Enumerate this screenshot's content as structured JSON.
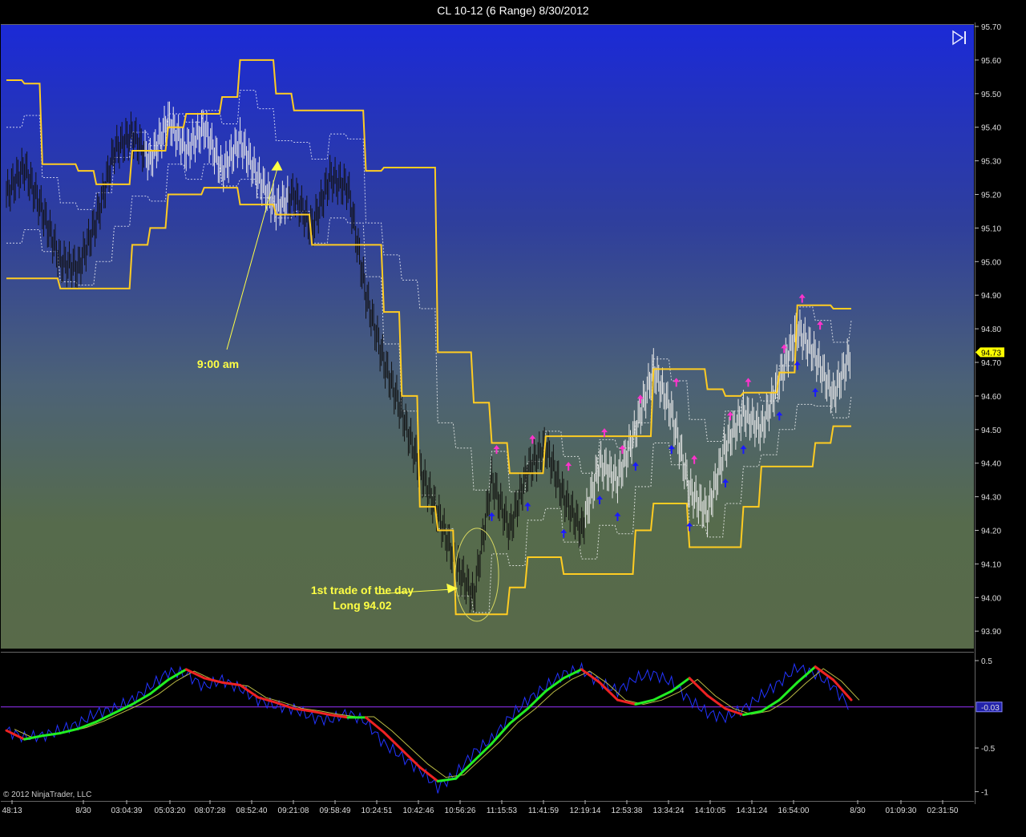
{
  "window": {
    "title": "CL 10-12 (6 Range)  8/30/2012"
  },
  "footer": {
    "copyright": "© 2012 NinjaTrader, LLC"
  },
  "icons": {
    "skip_end": "skip-to-end-icon"
  },
  "colors": {
    "band": "#ffcc22",
    "price_bar": "#111111",
    "bull_arrow": "#1a1aff",
    "bear_arrow": "#ff33cc",
    "osc_blue": "#2233ff",
    "osc_up": "#22ee22",
    "osc_down": "#ee2222",
    "osc_zero_line": "#9933ff"
  },
  "annotations": {
    "first_trade_line1": "1st trade of the day",
    "first_trade_line2": "Long 94.02",
    "nine_am": "9:00 am"
  },
  "chart_data": [
    {
      "type": "line",
      "panel": "price",
      "title": "CL 10-12 (6 Range)  8/30/2012",
      "yaxis_ticks": [
        "95.70",
        "95.60",
        "95.50",
        "95.40",
        "95.30",
        "95.20",
        "95.10",
        "95.00",
        "94.90",
        "94.80",
        "94.70",
        "94.60",
        "94.50",
        "94.40",
        "94.30",
        "94.20",
        "94.10",
        "94.00",
        "93.90"
      ],
      "ylim": [
        93.87,
        95.72
      ],
      "current_price_label": "94.73",
      "current_price": 94.73,
      "x_ticks": [
        "48:13",
        "8/30",
        "03:04:39",
        "05:03:20",
        "08:07:28",
        "08:52:40",
        "09:21:08",
        "09:58:49",
        "10:24:51",
        "10:42:46",
        "10:56:26",
        "11:15:53",
        "11:41:59",
        "12:19:14",
        "12:53:38",
        "13:34:24",
        "14:10:05",
        "14:31:24",
        "16:54:00",
        "8/30",
        "01:09:30",
        "02:31:50"
      ],
      "series": [
        {
          "name": "",
          "role": "upper-band",
          "values": [
            95.54,
            95.53,
            95.29,
            95.29,
            95.27,
            95.23,
            95.23,
            95.33,
            95.33,
            95.4,
            95.44,
            95.44,
            95.49,
            95.6,
            95.6,
            95.5,
            95.45,
            95.45,
            95.45,
            95.45,
            95.27,
            95.28,
            95.28,
            95.28,
            94.73,
            94.73,
            94.58,
            94.46,
            94.37,
            94.37,
            94.48,
            94.48,
            94.48,
            94.48,
            94.48,
            94.48,
            94.68,
            94.68,
            94.68,
            94.62,
            94.6,
            94.61,
            94.61,
            94.67,
            94.87,
            94.87,
            94.86,
            94.86
          ]
        },
        {
          "name": "",
          "role": "lower-band",
          "values": [
            94.95,
            94.95,
            94.95,
            94.92,
            94.92,
            94.92,
            94.92,
            95.05,
            95.1,
            95.2,
            95.2,
            95.22,
            95.22,
            95.17,
            95.17,
            95.14,
            95.14,
            95.05,
            95.05,
            95.05,
            95.05,
            94.85,
            94.6,
            94.27,
            94.2,
            93.95,
            93.95,
            93.95,
            94.03,
            94.12,
            94.12,
            94.07,
            94.07,
            94.07,
            94.07,
            94.2,
            94.28,
            94.28,
            94.15,
            94.15,
            94.15,
            94.27,
            94.39,
            94.39,
            94.39,
            94.46,
            94.51,
            94.51
          ]
        },
        {
          "name": "",
          "role": "price-close",
          "values": [
            95.2,
            95.28,
            95.15,
            95.0,
            94.98,
            95.12,
            95.33,
            95.38,
            95.3,
            95.42,
            95.33,
            95.4,
            95.27,
            95.36,
            95.25,
            95.16,
            95.2,
            95.1,
            95.25,
            95.22,
            94.9,
            94.7,
            94.55,
            94.38,
            94.25,
            94.1,
            94.0,
            94.35,
            94.2,
            94.38,
            94.45,
            94.3,
            94.2,
            94.4,
            94.35,
            94.5,
            94.68,
            94.55,
            94.32,
            94.25,
            94.45,
            94.55,
            94.5,
            94.65,
            94.8,
            94.72,
            94.6,
            94.73
          ]
        }
      ],
      "trade_markers": {
        "first_trade_price": 94.02
      }
    },
    {
      "type": "line",
      "panel": "oscillator",
      "yaxis_ticks": [
        "0.5",
        "-0.5",
        "-1"
      ],
      "ylim": [
        -1.0,
        0.55
      ],
      "current_value_label": "-0.03",
      "zero_line": -0.03,
      "series": [
        {
          "name": "",
          "role": "fast",
          "values": [
            -0.3,
            -0.38,
            -0.36,
            -0.3,
            -0.22,
            -0.1,
            -0.05,
            0.05,
            0.2,
            0.37,
            0.35,
            0.2,
            0.28,
            0.18,
            0.05,
            -0.02,
            -0.05,
            -0.15,
            -0.18,
            -0.1,
            -0.2,
            -0.45,
            -0.6,
            -0.75,
            -0.95,
            -0.8,
            -0.55,
            -0.4,
            -0.15,
            0.05,
            0.2,
            0.35,
            0.4,
            0.25,
            0.15,
            0.3,
            0.35,
            0.25,
            0.05,
            -0.1,
            -0.15,
            -0.05,
            0.1,
            0.25,
            0.42,
            0.35,
            0.2,
            -0.05
          ]
        },
        {
          "name": "",
          "role": "smooth",
          "values": [
            -0.3,
            -0.4,
            -0.36,
            -0.33,
            -0.28,
            -0.2,
            -0.1,
            0.0,
            0.12,
            0.28,
            0.4,
            0.3,
            0.25,
            0.22,
            0.08,
            0.02,
            -0.05,
            -0.08,
            -0.12,
            -0.15,
            -0.15,
            -0.32,
            -0.52,
            -0.72,
            -0.88,
            -0.85,
            -0.65,
            -0.45,
            -0.22,
            -0.05,
            0.15,
            0.3,
            0.4,
            0.25,
            0.05,
            0.0,
            0.05,
            0.15,
            0.3,
            0.1,
            -0.05,
            -0.12,
            -0.08,
            0.05,
            0.25,
            0.43,
            0.28,
            0.05
          ]
        }
      ]
    }
  ]
}
